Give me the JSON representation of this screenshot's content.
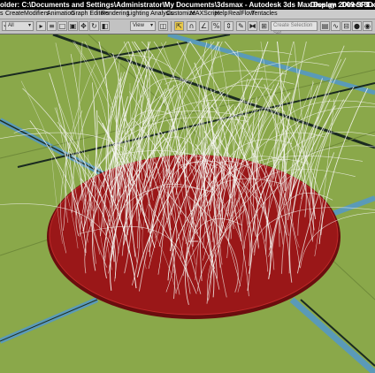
{
  "window": {
    "title": "older: C:\\Documents and Settings\\Administrator\\My Documents\\3dsmax     - Autodesk 3ds Max Design 2009 SP1  x64",
    "display": "Display : Direct 3D"
  },
  "menu": [
    "s",
    "Create",
    "Modifiers",
    "Animation",
    "Graph Editors",
    "Rendering",
    "Lighting Analysis",
    "Customize",
    "MAXScript",
    "Help",
    "RealFlow",
    "Tentacles"
  ],
  "toolbar": {
    "selection_filter": "All",
    "reference_coord": "View",
    "named_selection_placeholder": "Create Selection Set",
    "icons": [
      "undo-icon",
      "redo-icon",
      "select-object-icon",
      "select-by-name-icon",
      "rectangular-selection-icon",
      "window-crossing-icon",
      "select-move-icon",
      "select-rotate-icon",
      "select-scale-icon",
      "pivot-icon",
      "manipulate-icon",
      "snaps-icon",
      "angle-snap-icon",
      "percent-snap-icon",
      "spinner-snap-icon",
      "edit-named-selection-icon",
      "mirror-icon",
      "align-icon",
      "layer-manager-icon",
      "curve-editor-icon",
      "schematic-view-icon",
      "material-editor-icon",
      "render-setup-icon",
      "render-icon"
    ]
  },
  "colors": {
    "ground": "#8aa84a",
    "disc": "#9a1718",
    "hair": "#f4f4f0",
    "road_blue": "#5a9ab8",
    "road_dark": "#1a2a20"
  }
}
